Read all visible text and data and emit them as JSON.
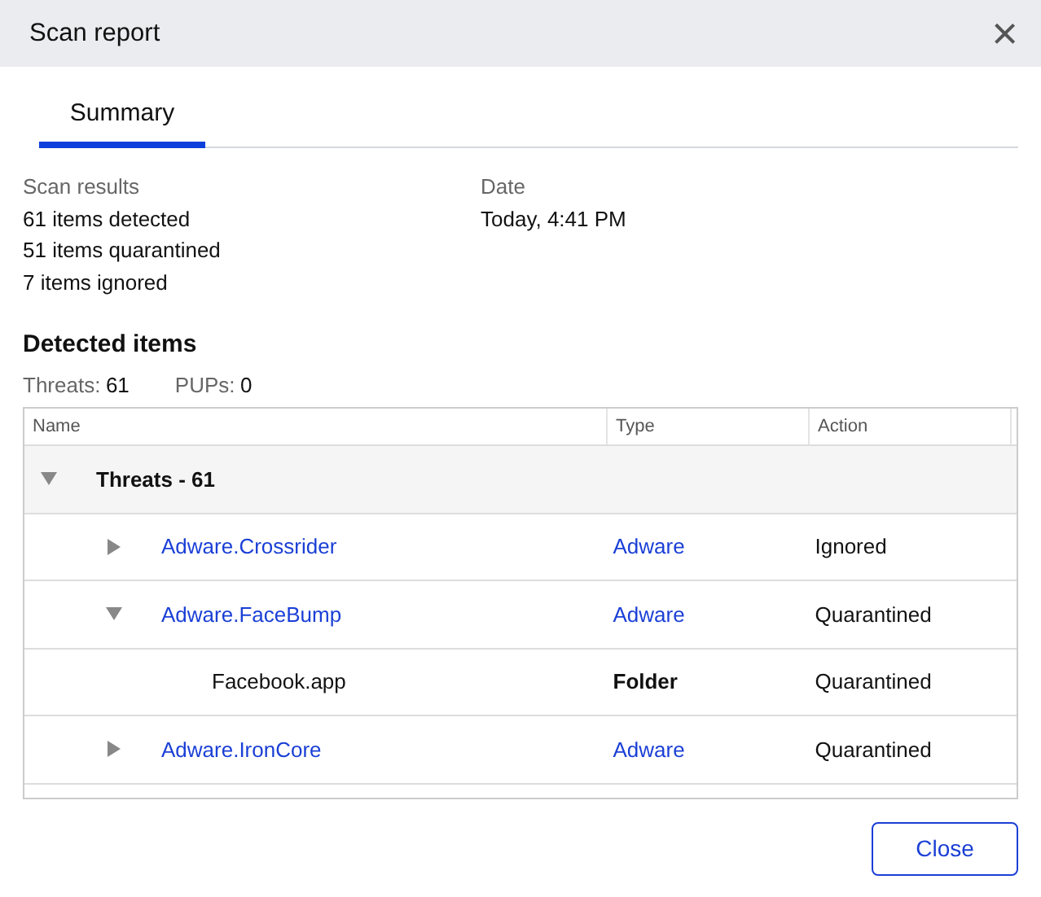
{
  "window": {
    "title": "Scan report",
    "close_icon": "×"
  },
  "tabs": [
    {
      "label": "Summary",
      "selected": true
    }
  ],
  "scan_results": {
    "label": "Scan results",
    "lines": [
      "61 items detected",
      "51 items quarantined",
      "7 items ignored"
    ]
  },
  "date": {
    "label": "Date",
    "value": "Today, 4:41 PM"
  },
  "detected_items": {
    "title": "Detected items",
    "counts": [
      {
        "label": "Threats:",
        "value": "61"
      },
      {
        "label": "PUPs:",
        "value": "0"
      }
    ]
  },
  "table": {
    "columns": [
      "Name",
      "Type",
      "Action"
    ],
    "rows": [
      {
        "kind": "group",
        "name": "Threats - 61",
        "expanded": true,
        "children": [
          {
            "kind": "item",
            "name": "Adware.Crossrider",
            "type": "Adware",
            "action": "Ignored",
            "expanded": false
          },
          {
            "kind": "item",
            "name": "Adware.FaceBump",
            "type": "Adware",
            "action": "Quarantined",
            "expanded": true,
            "children": [
              {
                "kind": "file",
                "name": "Facebook.app",
                "type": "Folder",
                "action": "Quarantined"
              }
            ]
          },
          {
            "kind": "item",
            "name": "Adware.IronCore",
            "type": "Adware",
            "action": "Quarantined",
            "expanded": false
          }
        ]
      }
    ]
  },
  "buttons": [
    "Close"
  ]
}
